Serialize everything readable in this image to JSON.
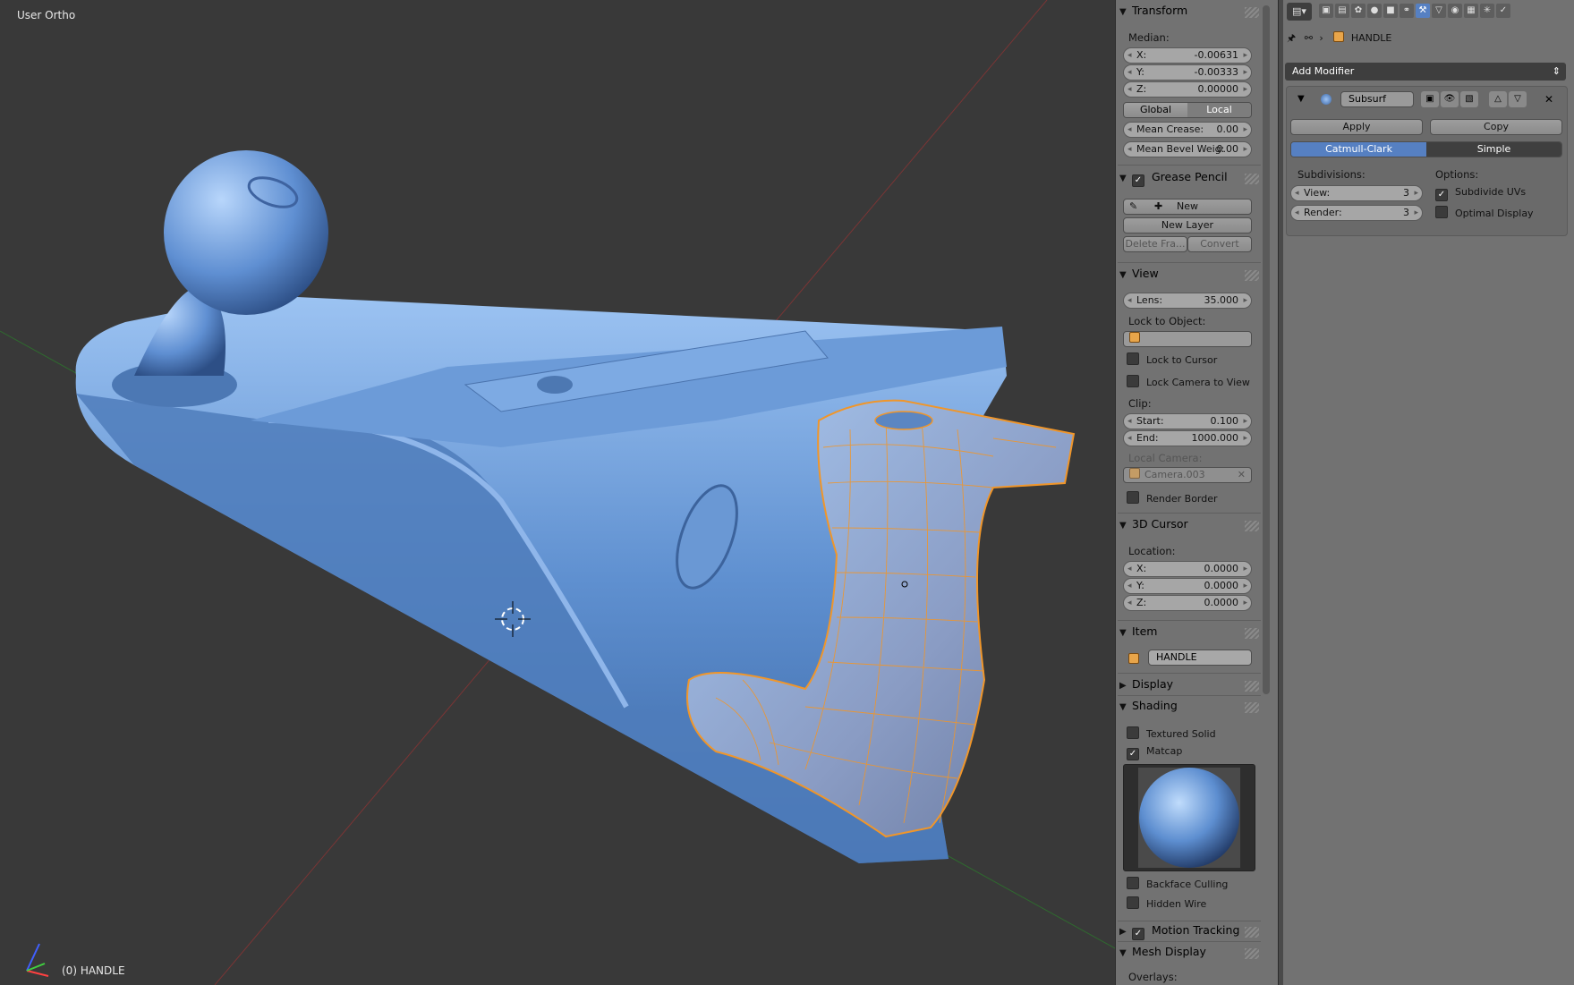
{
  "viewport": {
    "view_name": "User Ortho",
    "object_label": "(0) HANDLE"
  },
  "npanel": {
    "transform": {
      "header": "Transform",
      "median_label": "Median:",
      "x": {
        "label": "X:",
        "value": "-0.00631"
      },
      "y": {
        "label": "Y:",
        "value": "-0.00333"
      },
      "z": {
        "label": "Z:",
        "value": "0.00000"
      },
      "global_label": "Global",
      "local_label": "Local",
      "mean_crease": {
        "label": "Mean Crease:",
        "value": "0.00"
      },
      "mean_bevel": {
        "label": "Mean Bevel Weig:",
        "value": "0.00"
      }
    },
    "grease_pencil": {
      "header": "Grease Pencil",
      "new_label": "New",
      "new_layer_label": "New Layer",
      "delete_frame_label": "Delete Fra...",
      "convert_label": "Convert"
    },
    "view": {
      "header": "View",
      "lens": {
        "label": "Lens:",
        "value": "35.000"
      },
      "lock_to_object_label": "Lock to Object:",
      "lock_to_cursor_label": "Lock to Cursor",
      "lock_camera_label": "Lock Camera to View",
      "clip_label": "Clip:",
      "start": {
        "label": "Start:",
        "value": "0.100"
      },
      "end": {
        "label": "End:",
        "value": "1000.000"
      },
      "local_camera_label": "Local Camera:",
      "local_camera_value": "Camera.003",
      "render_border_label": "Render Border"
    },
    "cursor": {
      "header": "3D Cursor",
      "location_label": "Location:",
      "x": {
        "label": "X:",
        "value": "0.0000"
      },
      "y": {
        "label": "Y:",
        "value": "0.0000"
      },
      "z": {
        "label": "Z:",
        "value": "0.0000"
      }
    },
    "item": {
      "header": "Item",
      "name": "HANDLE"
    },
    "display": {
      "header": "Display"
    },
    "shading": {
      "header": "Shading",
      "textured_solid_label": "Textured Solid",
      "matcap_label": "Matcap",
      "backface_culling_label": "Backface Culling",
      "hidden_wire_label": "Hidden Wire"
    },
    "motion_tracking": {
      "header": "Motion Tracking"
    },
    "mesh_display": {
      "header": "Mesh Display",
      "overlays_label": "Overlays:"
    }
  },
  "properties": {
    "breadcrumb_object": "HANDLE",
    "add_modifier_label": "Add Modifier",
    "modifier": {
      "name": "Subsurf",
      "apply_label": "Apply",
      "copy_label": "Copy",
      "catmull_label": "Catmull-Clark",
      "simple_label": "Simple",
      "subdivisions_label": "Subdivisions:",
      "options_label": "Options:",
      "view": {
        "label": "View:",
        "value": "3"
      },
      "render": {
        "label": "Render:",
        "value": "3"
      },
      "subdivide_uvs_label": "Subdivide UVs",
      "optimal_display_label": "Optimal Display"
    }
  },
  "colors": {
    "viewport_bg": "#393939",
    "panel_bg": "#727272",
    "accent_blue": "#5680c2",
    "model_blue": "#6f9fdc",
    "selection_orange": "#f0962a"
  }
}
